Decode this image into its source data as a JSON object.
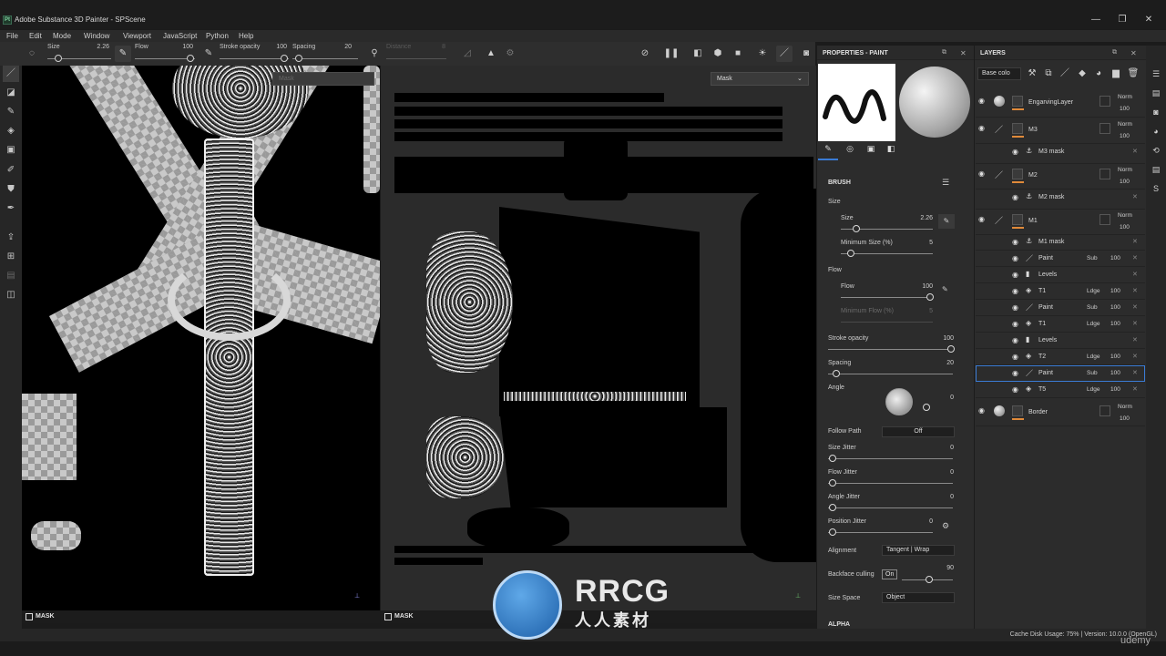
{
  "window": {
    "title": "Adobe Substance 3D Painter - SPScene",
    "logo_text": "Pt",
    "controls": [
      "—",
      "❐",
      "✕"
    ]
  },
  "menu": [
    "File",
    "Edit",
    "Mode",
    "Window",
    "Viewport",
    "JavaScript",
    "Python",
    "Help"
  ],
  "toolbar": {
    "size_label": "Size",
    "size_value": "2.26",
    "flow_label": "Flow",
    "flow_value": "100",
    "stroke_opacity_label": "Stroke opacity",
    "stroke_opacity_value": "100",
    "spacing_label": "Spacing",
    "spacing_value": "20",
    "distance_label": "Distance",
    "distance_value": "8"
  },
  "viewports": {
    "left_mask_dropdown": "Mask",
    "right_mask_dropdown": "Mask",
    "left_footer": "MASK",
    "right_footer": "MASK"
  },
  "properties": {
    "title": "PROPERTIES - PAINT",
    "brush_header": "BRUSH",
    "size_section": "Size",
    "size_label": "Size",
    "size_value": "2.26",
    "min_size_label": "Minimum Size (%)",
    "min_size_value": "5",
    "flow_section": "Flow",
    "flow_label": "Flow",
    "flow_value": "100",
    "min_flow_label": "Minimum Flow (%)",
    "min_flow_value": "5",
    "stroke_opacity_label": "Stroke opacity",
    "stroke_opacity_value": "100",
    "spacing_label": "Spacing",
    "spacing_value": "20",
    "angle_label": "Angle",
    "angle_value": "0",
    "follow_path_label": "Follow Path",
    "follow_path_value": "Off",
    "size_jitter_label": "Size Jitter",
    "size_jitter_value": "0",
    "flow_jitter_label": "Flow Jitter",
    "flow_jitter_value": "0",
    "angle_jitter_label": "Angle Jitter",
    "angle_jitter_value": "0",
    "position_jitter_label": "Position Jitter",
    "position_jitter_value": "0",
    "alignment_label": "Alignment",
    "alignment_value": "Tangent | Wrap",
    "backface_label": "Backface culling",
    "backface_toggle": "On",
    "backface_value": "90",
    "size_space_label": "Size Space",
    "size_space_value": "Object",
    "alpha_header": "ALPHA"
  },
  "layers": {
    "title": "LAYERS",
    "channel_dropdown": "Base colo",
    "rows": [
      {
        "name": "EngarvingLayer",
        "blend": "Norm",
        "opacity": "100",
        "kind": "fill"
      },
      {
        "name": "M3",
        "blend": "Norm",
        "opacity": "100",
        "kind": "paint"
      },
      {
        "name": "M3 mask",
        "kind": "mask"
      },
      {
        "name": "M2",
        "blend": "Norm",
        "opacity": "100",
        "kind": "paint"
      },
      {
        "name": "M2 mask",
        "kind": "mask"
      },
      {
        "name": "M1",
        "blend": "Norm",
        "opacity": "100",
        "kind": "paint"
      },
      {
        "name": "M1 mask",
        "kind": "mask"
      },
      {
        "name": "Paint",
        "blend": "Sub",
        "opacity": "100",
        "kind": "effect"
      },
      {
        "name": "Levels",
        "kind": "effect"
      },
      {
        "name": "T1",
        "blend": "Ldge",
        "opacity": "100",
        "kind": "effect"
      },
      {
        "name": "Paint",
        "blend": "Sub",
        "opacity": "100",
        "kind": "effect"
      },
      {
        "name": "T1",
        "blend": "Ldge",
        "opacity": "100",
        "kind": "effect"
      },
      {
        "name": "Levels",
        "kind": "effect"
      },
      {
        "name": "T2",
        "blend": "Ldge",
        "opacity": "100",
        "kind": "effect"
      },
      {
        "name": "Paint",
        "blend": "Sub",
        "opacity": "100",
        "kind": "effect"
      },
      {
        "name": "T5",
        "blend": "Ldge",
        "opacity": "100",
        "kind": "effect"
      },
      {
        "name": "Border",
        "blend": "Norm",
        "opacity": "100",
        "kind": "fill"
      }
    ]
  },
  "status": {
    "text": "Cache Disk Usage:   75% | Version: 10.0.0 (OpenGL)"
  },
  "watermark": {
    "brand": "RRCG",
    "subtitle": "人人素材",
    "corner": "udemy"
  },
  "colors": {
    "accent_orange": "#e08a3a",
    "selection_blue": "#3a7bd5"
  }
}
